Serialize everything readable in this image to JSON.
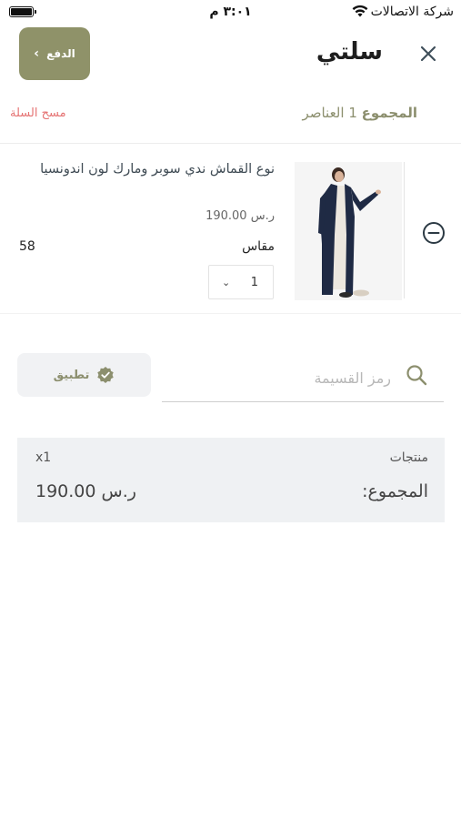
{
  "status_bar": {
    "carrier": "شركة الاتصالات",
    "time": "٣:٠١ م",
    "icons": [
      "battery-icon",
      "wifi-icon"
    ]
  },
  "header": {
    "title": "سلتي",
    "checkout_label": "الدفع",
    "icons": [
      "close-icon",
      "chevron-left-icon"
    ]
  },
  "cart_summary": {
    "total_label": "المجموع",
    "items_count": "1 العناصر",
    "clear_cart": "مسح السلة"
  },
  "items": [
    {
      "name": "نوع القماش ندي سوبر ومارك لون اندونسيا",
      "price": "ر.س 190.00",
      "size_label": "مقاس",
      "size_value": "58",
      "quantity": "1",
      "icons": [
        "remove-circle-icon",
        "chevron-down-icon"
      ]
    }
  ],
  "coupon": {
    "placeholder": "رمز القسيمة",
    "apply_label": "تطبيق",
    "icons": [
      "search-icon",
      "verified-badge-icon"
    ]
  },
  "totals": {
    "products_label": "منتجات",
    "products_qty": "x1",
    "total_label": "المجموع:",
    "total_value": "ر.س 190.00"
  },
  "colors": {
    "accent": "#8f9269",
    "accent_text": "#8c8f6e",
    "danger": "#e57373",
    "panel": "#eff1f3",
    "abaya": "#1f2a44"
  }
}
